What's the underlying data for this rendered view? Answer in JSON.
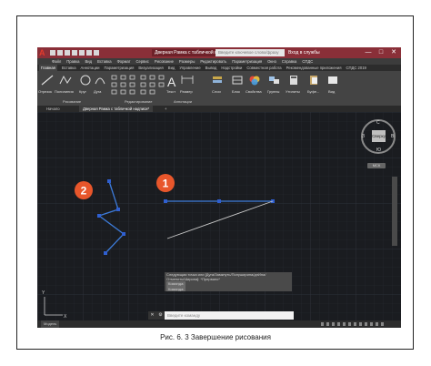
{
  "app": {
    "logo": "A",
    "window_title": "Дверная Рамка с табличкой надписи",
    "search_placeholder": "Введите ключевое слово/фразу",
    "signin": "Вход в службы",
    "minimize": "—",
    "maximize": "□",
    "close": "✕"
  },
  "menubar": [
    "Файл",
    "Правка",
    "Вид",
    "Вставка",
    "Формат",
    "Сервис",
    "Рисование",
    "Размеры",
    "Редактировать",
    "Параметризация",
    "Окно",
    "Справка",
    "СПДС"
  ],
  "ribbon_tabs": [
    "Главная",
    "Вставка",
    "Аннотации",
    "Параметризация",
    "Визуализация",
    "Вид",
    "Управление",
    "Вывод",
    "Надстройки",
    "Совместная работа",
    "Рекомендованные приложения",
    "СПДС 2019"
  ],
  "ribbon": {
    "tools": {
      "polyline": "Отрезок",
      "polyline2": "Полилиния",
      "circle": "Круг",
      "arc": "Дуга",
      "text": "Текст",
      "dimension": "Размер",
      "layers": "Слои",
      "block": "Блок",
      "properties": "Свойства",
      "groups": "Группы",
      "utilities": "Утилиты",
      "clipboard": "Буфе...",
      "view": "Вид"
    },
    "panels": {
      "draw": "Рисование",
      "modify": "Редактирование",
      "annotation": "Аннотации"
    }
  },
  "doc_tabs": {
    "start": "Начало",
    "active": "Дверная Рамка с табличкой надписи*",
    "add": "+"
  },
  "viewcube": {
    "face": "Сверху",
    "north": "С",
    "south": "Ю",
    "west": "З",
    "east": "В",
    "wcs": "МСК"
  },
  "command": {
    "history": [
      "Следующая точка или [Дуга/Замкнуть/Полуширина/длИна/",
      "Отменить/Ширина]: *Прервано*",
      "Команда:",
      "Команда:"
    ],
    "placeholder": "Введите команду"
  },
  "status": {
    "model": "Модель"
  },
  "badges": {
    "one": "1",
    "two": "2"
  },
  "ucs": {
    "x": "X",
    "y": "Y"
  },
  "caption": "Рис. 6. 3 Завершение рисования",
  "colors": {
    "titlebar": "#8a2f38",
    "badge": "#e8562b",
    "polyline": "#3d7bd9",
    "grip": "#2f5fd0",
    "line": "#c8c8c8"
  }
}
